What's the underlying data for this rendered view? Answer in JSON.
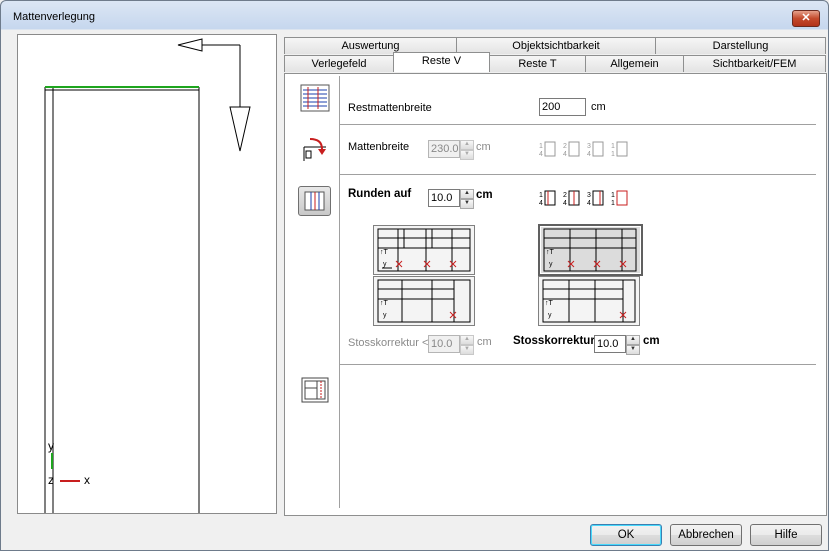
{
  "window": {
    "title": "Mattenverlegung",
    "close_glyph": "✕"
  },
  "preview": {
    "axis_y": "y",
    "axis_z": "z",
    "axis_x": "x"
  },
  "tabs_top": [
    {
      "label": "Auswertung"
    },
    {
      "label": "Objektsichtbarkeit"
    },
    {
      "label": "Darstellung"
    }
  ],
  "tabs_bottom": [
    {
      "label": "Verlegefeld"
    },
    {
      "label": "Reste V"
    },
    {
      "label": "Reste T"
    },
    {
      "label": "Allgemein"
    },
    {
      "label": "Sichtbarkeit/FEM"
    }
  ],
  "restmatten": {
    "label": "Restmattenbreite",
    "value": "200",
    "unit": "cm"
  },
  "mattenbreite": {
    "label": "Mattenbreite",
    "value": "230.0",
    "unit": "cm",
    "fractions": [
      "1/4",
      "2/4",
      "3/4",
      "1/1"
    ]
  },
  "runden": {
    "label": "Runden auf",
    "value": "10.0",
    "unit": "cm",
    "fractions": [
      "1/4",
      "2/4",
      "3/4",
      "1/1"
    ]
  },
  "stoss_left": {
    "label": "Stosskorrektur <",
    "value": "10.0",
    "unit": "cm"
  },
  "stoss_right": {
    "label": "Stosskorrektur <",
    "value": "10.0",
    "unit": "cm"
  },
  "buttons": {
    "ok": "OK",
    "cancel": "Abbrechen",
    "help": "Hilfe"
  },
  "colors": {
    "accent_green": "#1ea51e",
    "accent_red": "#c81e1e"
  }
}
